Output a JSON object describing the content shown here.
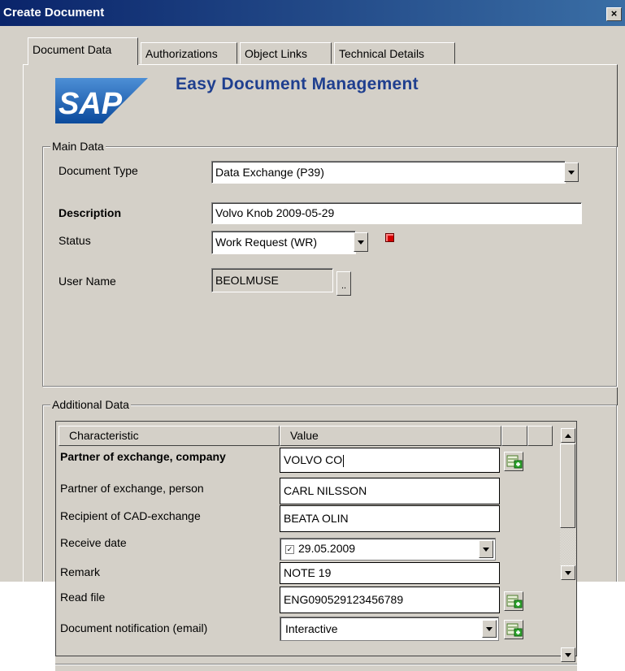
{
  "window": {
    "title": "Create Document",
    "close_label": "×"
  },
  "tabs": [
    {
      "label": "Document Data",
      "active": true
    },
    {
      "label": "Authorizations",
      "active": false
    },
    {
      "label": "Object Links",
      "active": false
    },
    {
      "label": "Technical Details",
      "active": false
    }
  ],
  "header": {
    "logo_text": "SAP",
    "title": "Easy Document Management"
  },
  "main_data": {
    "group_title": "Main Data",
    "document_type": {
      "label": "Document Type",
      "value": "Data Exchange (P39)"
    },
    "description": {
      "label": "Description",
      "value": "Volvo Knob 2009-05-29"
    },
    "status": {
      "label": "Status",
      "value": "Work Request (WR)"
    },
    "user_name": {
      "label": "User Name",
      "value": "BEOLMUSE",
      "browse_label": ".."
    }
  },
  "additional_data": {
    "group_title": "Additional Data",
    "columns": {
      "characteristic": "Characteristic",
      "value": "Value"
    },
    "rows": [
      {
        "characteristic": "Partner of exchange, company",
        "value": "VOLVO CO"
      },
      {
        "characteristic": "Partner of exchange, person",
        "value": "CARL NILSSON"
      },
      {
        "characteristic": "Recipient of CAD-exchange",
        "value": "BEATA OLIN"
      },
      {
        "characteristic": "Receive date",
        "value": "29.05.2009",
        "checked": true
      },
      {
        "characteristic": "Remark",
        "value": "NOTE 19"
      },
      {
        "characteristic": "Read file",
        "value": "ENG090529123456789"
      },
      {
        "characteristic": "Document notification (email)",
        "value": "Interactive"
      }
    ]
  },
  "colors": {
    "title_bar": "#0a246a",
    "dialog_bg": "#d4d0c8",
    "brand_blue": "#1f3f8f",
    "status_red": "#d40000"
  },
  "icons": [
    "close-icon",
    "sap-logo",
    "status-icon",
    "add-row-icon",
    "scroll-up-icon",
    "scroll-down-icon",
    "checkbox-icon"
  ]
}
